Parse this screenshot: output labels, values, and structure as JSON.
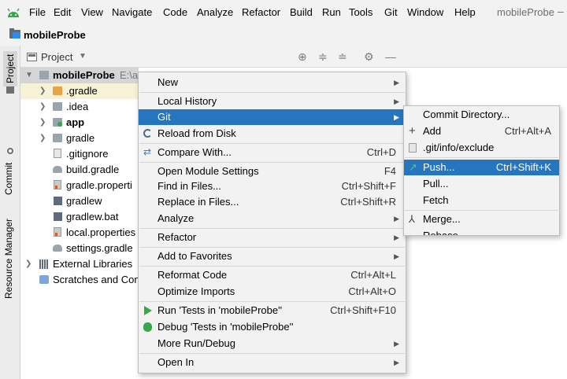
{
  "menubar": {
    "items": [
      "File",
      "Edit",
      "View",
      "Navigate",
      "Code",
      "Analyze",
      "Refactor",
      "Build",
      "Run",
      "Tools",
      "Git",
      "Window",
      "Help"
    ],
    "window_title": "mobileProbe",
    "min_glyph": "–"
  },
  "breadcrumb": {
    "project": "mobileProbe"
  },
  "leftstrip": {
    "tabs": [
      "Project",
      "Commit",
      "Resource Manager"
    ]
  },
  "panel": {
    "title": "Project"
  },
  "tree": {
    "root": {
      "name": "mobileProbe",
      "path": "E:\\a..."
    },
    "items": [
      ".gradle",
      ".idea",
      "app",
      "gradle",
      ".gitignore",
      "build.gradle",
      "gradle.properti",
      "gradlew",
      "gradlew.bat",
      "local.properties",
      "settings.gradle",
      "External Libraries",
      "Scratches and Con"
    ]
  },
  "context_menu": {
    "items": [
      {
        "label": "New",
        "shortcut": "",
        "submenu": true
      },
      {
        "label": "Local History",
        "shortcut": "",
        "submenu": true
      },
      {
        "label": "Git",
        "shortcut": "",
        "submenu": true,
        "selected": true
      },
      {
        "label": "Reload from Disk",
        "shortcut": "",
        "submenu": false
      },
      {
        "label": "Compare With...",
        "shortcut": "Ctrl+D",
        "submenu": false
      },
      {
        "label": "Open Module Settings",
        "shortcut": "F4",
        "submenu": false
      },
      {
        "label": "Find in Files...",
        "shortcut": "Ctrl+Shift+F",
        "submenu": false
      },
      {
        "label": "Replace in Files...",
        "shortcut": "Ctrl+Shift+R",
        "submenu": false
      },
      {
        "label": "Analyze",
        "shortcut": "",
        "submenu": true
      },
      {
        "label": "Refactor",
        "shortcut": "",
        "submenu": true
      },
      {
        "label": "Add to Favorites",
        "shortcut": "",
        "submenu": true
      },
      {
        "label": "Reformat Code",
        "shortcut": "Ctrl+Alt+L",
        "submenu": false
      },
      {
        "label": "Optimize Imports",
        "shortcut": "Ctrl+Alt+O",
        "submenu": false
      },
      {
        "label": "Run 'Tests in 'mobileProbe''",
        "shortcut": "Ctrl+Shift+F10",
        "submenu": false
      },
      {
        "label": "Debug 'Tests in 'mobileProbe''",
        "shortcut": "",
        "submenu": false
      },
      {
        "label": "More Run/Debug",
        "shortcut": "",
        "submenu": true
      },
      {
        "label": "Open In",
        "shortcut": "",
        "submenu": true
      }
    ]
  },
  "git_submenu": {
    "items": [
      {
        "label": "Commit Directory...",
        "shortcut": ""
      },
      {
        "label": "Add",
        "shortcut": "Ctrl+Alt+A"
      },
      {
        "label": ".git/info/exclude",
        "shortcut": ""
      },
      {
        "label": "Push...",
        "shortcut": "Ctrl+Shift+K",
        "selected": true
      },
      {
        "label": "Pull...",
        "shortcut": ""
      },
      {
        "label": "Fetch",
        "shortcut": ""
      },
      {
        "label": "Merge...",
        "shortcut": ""
      },
      {
        "label": "Rebase...",
        "shortcut": ""
      }
    ]
  },
  "colors": {
    "selection": "#2675bf",
    "menu_bg": "#f2f2f2",
    "folder_orange": "#e8a24a"
  },
  "icons": [
    "android-logo-icon",
    "folder-icon",
    "gear-icon",
    "minimize-icon",
    "locate-icon",
    "expand-all-icon",
    "collapse-all-icon",
    "push-arrow-icon",
    "run-icon",
    "debug-icon",
    "reload-icon",
    "compare-icon",
    "add-icon",
    "merge-icon"
  ]
}
